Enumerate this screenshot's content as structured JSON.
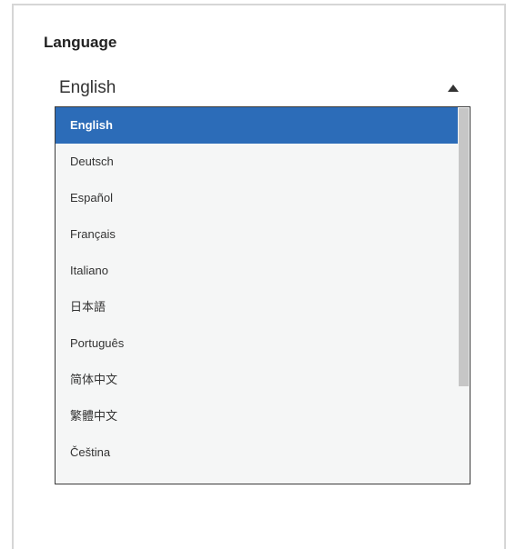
{
  "language_setting": {
    "label": "Language",
    "selected_value": "English",
    "options": [
      "English",
      "Deutsch",
      "Español",
      "Français",
      "Italiano",
      "日本語",
      "Português",
      "简体中文",
      "繁體中文",
      "Čeština"
    ],
    "selected_index": 0
  },
  "colors": {
    "selected_background": "#2c6cb8",
    "list_background": "#f5f6f6",
    "frame_border": "#d6d6d6"
  }
}
